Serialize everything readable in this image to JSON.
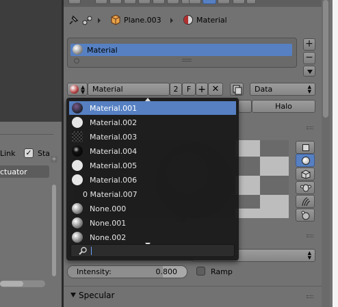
{
  "header": {
    "object_name": "Plane.003",
    "context_name": "Material"
  },
  "material_slots": {
    "items": [
      {
        "label": "Material"
      }
    ]
  },
  "material_selector": {
    "name": "Material",
    "users_count": "2",
    "fake_user": "F",
    "link_value": "Data"
  },
  "type_tabs": {
    "halo": "Halo"
  },
  "dropdown": {
    "items": [
      {
        "label": "Material.001",
        "icon": "material-preview-dark-sphere",
        "active": true
      },
      {
        "label": "Material.002",
        "icon": "material-preview-white-sphere"
      },
      {
        "label": "Material.003",
        "icon": "material-preview-checker-sphere"
      },
      {
        "label": "Material.004",
        "icon": "material-preview-black-sphere"
      },
      {
        "label": "Material.005",
        "icon": "material-preview-white-sphere"
      },
      {
        "label": "Material.006",
        "icon": "material-preview-white-sphere"
      },
      {
        "label": "0 Material.007",
        "icon": "material-preview-none"
      },
      {
        "label": "None.000",
        "icon": "material-preview-grey-sphere"
      },
      {
        "label": "None.001",
        "icon": "material-preview-grey-sphere"
      },
      {
        "label": "None.002",
        "icon": "material-preview-grey-sphere"
      }
    ],
    "search_value": ""
  },
  "left_panel": {
    "link_label": "Link",
    "state_label": "Sta",
    "actuator_label": "ctuator"
  },
  "properties": {
    "intensity_label": "Intensity:",
    "intensity_value": "0.800",
    "ramp_label": "Ramp",
    "specular_label": "Specular"
  },
  "colors": {
    "selection": "#5680c2",
    "panel_bg": "#727272",
    "menu_bg": "#181818"
  }
}
